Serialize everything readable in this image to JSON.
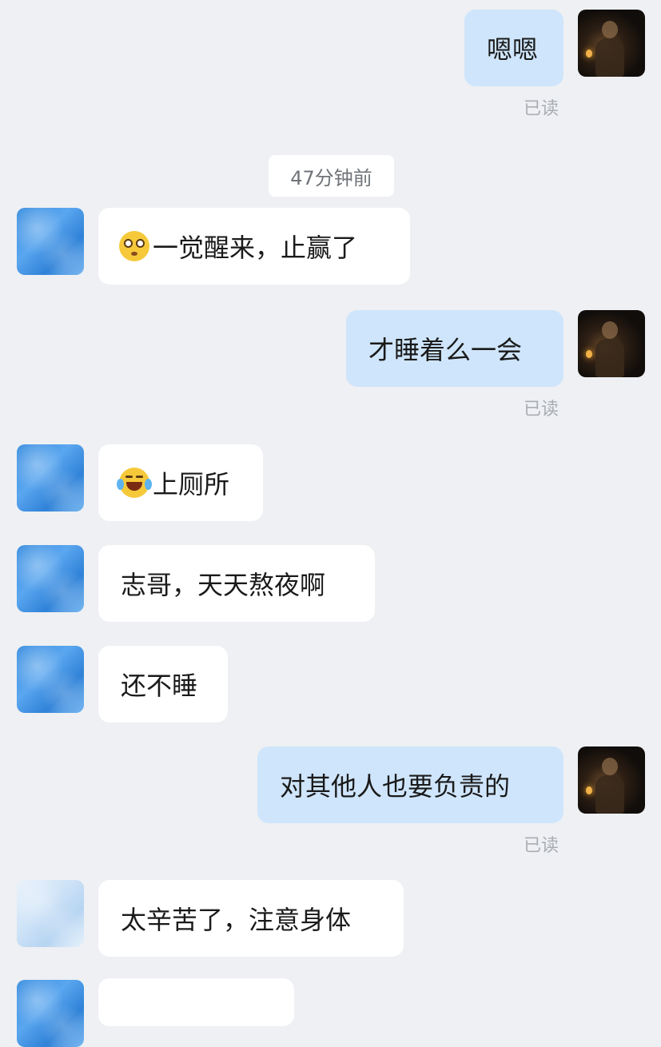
{
  "chat": {
    "timestamp": "47分钟前",
    "read_label": "已读",
    "messages": [
      {
        "sender": "me",
        "text": "嗯嗯",
        "status": "已读"
      },
      {
        "sender": "other",
        "text": "一觉醒来，止赢了",
        "emoji": "flushed-face-icon"
      },
      {
        "sender": "me",
        "text": "才睡着么一会",
        "status": "已读"
      },
      {
        "sender": "other",
        "text": "上厕所",
        "emoji": "face-with-tears-of-joy-icon"
      },
      {
        "sender": "other",
        "text": "志哥，天天熬夜啊"
      },
      {
        "sender": "other",
        "text": "还不睡"
      },
      {
        "sender": "me",
        "text": "对其他人也要负责的",
        "status": "已读"
      },
      {
        "sender": "other",
        "text": "太辛苦了，注意身体"
      }
    ]
  },
  "colors": {
    "background": "#eef0f3",
    "bubble_me": "#cfe5fb",
    "bubble_other": "#ffffff",
    "read_text": "#a9adb3"
  }
}
